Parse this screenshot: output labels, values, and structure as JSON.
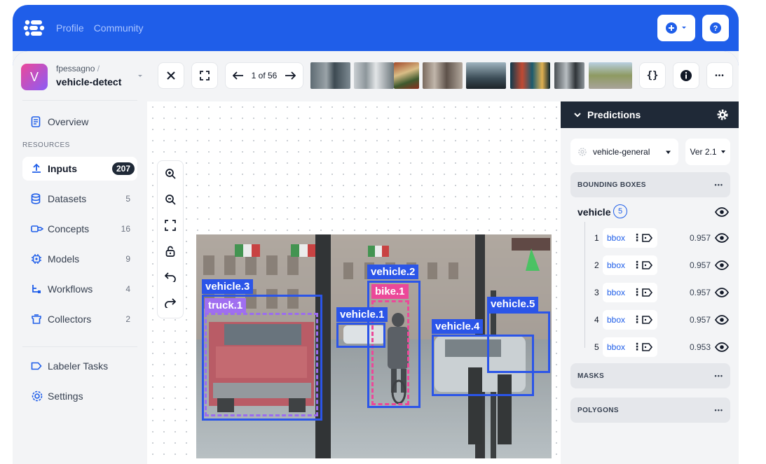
{
  "topbar": {
    "nav": [
      "Profile",
      "Community"
    ],
    "add_label": "+",
    "help_label": "?"
  },
  "sidebar": {
    "owner": "fpessagno",
    "owner_sep": "/",
    "app_name": "vehicle-detect",
    "avatar_letter": "V",
    "overview": "Overview",
    "section_label": "RESOURCES",
    "items": [
      {
        "label": "Inputs",
        "count": "207",
        "icon": "upload-icon"
      },
      {
        "label": "Datasets",
        "count": "5",
        "icon": "database-icon"
      },
      {
        "label": "Concepts",
        "count": "16",
        "icon": "concepts-icon"
      },
      {
        "label": "Models",
        "count": "9",
        "icon": "model-icon"
      },
      {
        "label": "Workflows",
        "count": "4",
        "icon": "workflow-icon"
      },
      {
        "label": "Collectors",
        "count": "2",
        "icon": "collector-icon"
      }
    ],
    "labeler_tasks": "Labeler Tasks",
    "settings": "Settings"
  },
  "viewer": {
    "pager": "1 of 56",
    "code_label": "{}",
    "more_label": "•••",
    "labels": {
      "vehicle3": "vehicle.3",
      "truck1": "truck.1",
      "vehicle2": "vehicle.2",
      "bike1": "bike.1",
      "vehicle1": "vehicle.1",
      "vehicle4": "vehicle.4",
      "vehicle5": "vehicle.5"
    }
  },
  "panel": {
    "title": "Predictions",
    "model": "vehicle-general",
    "version": "Ver 2.1",
    "bbox_section": "BOUNDING BOXES",
    "group": "vehicle",
    "group_count": "5",
    "rows": [
      {
        "num": "1",
        "type": "bbox",
        "score": "0.957"
      },
      {
        "num": "2",
        "type": "bbox",
        "score": "0.957"
      },
      {
        "num": "3",
        "type": "bbox",
        "score": "0.957"
      },
      {
        "num": "4",
        "type": "bbox",
        "score": "0.957"
      },
      {
        "num": "5",
        "type": "bbox",
        "score": "0.953"
      }
    ],
    "masks": "MASKS",
    "polygons": "POLYGONS",
    "dots": "•••"
  },
  "colors": {
    "brand": "#1f5ee9",
    "bbox": "#2b55e8",
    "truck": "#a06ef0",
    "bike": "#ec4899"
  }
}
